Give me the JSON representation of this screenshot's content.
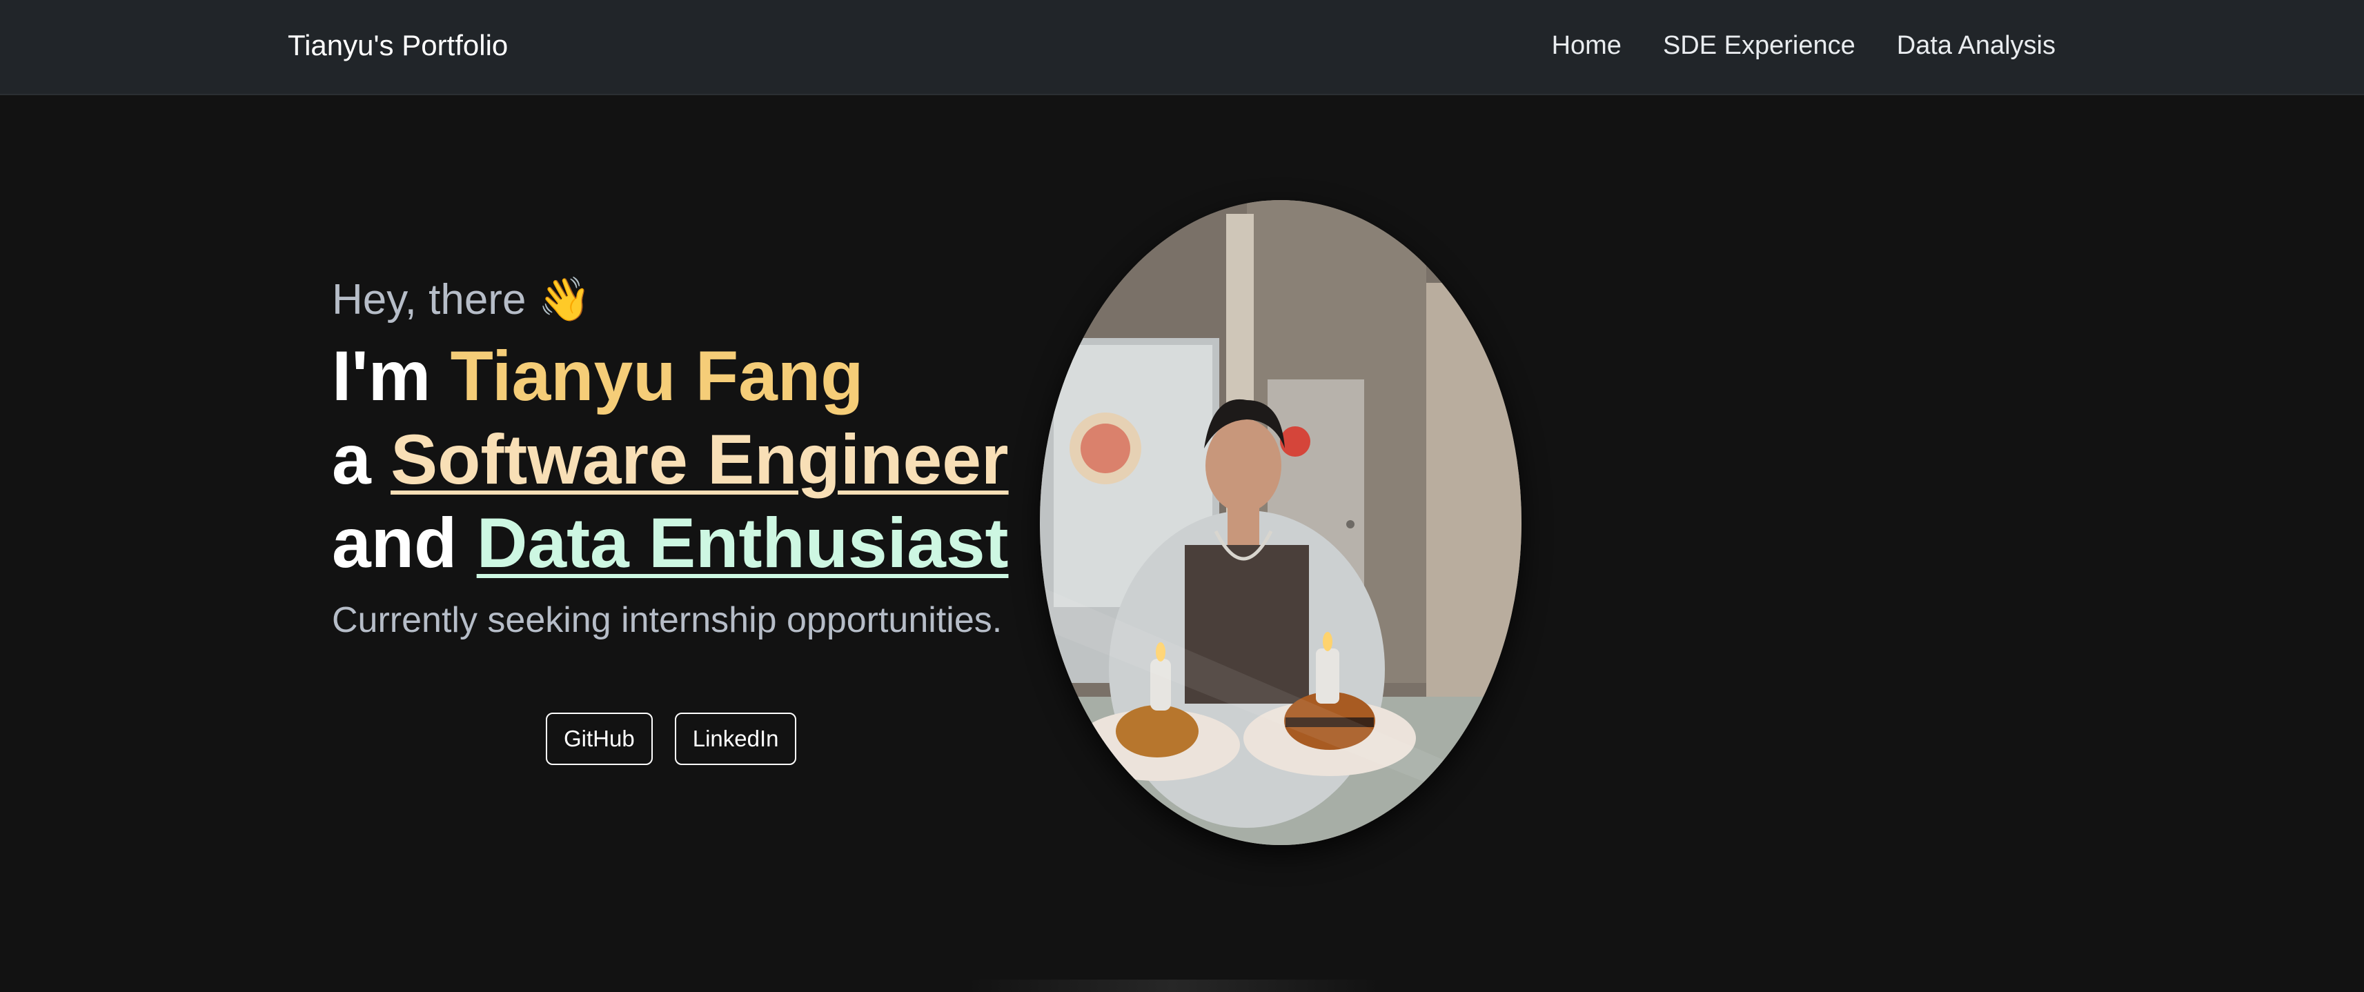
{
  "navbar": {
    "brand": "Tianyu's Portfolio",
    "links": [
      {
        "label": "Home"
      },
      {
        "label": "SDE Experience"
      },
      {
        "label": "Data Analysis"
      }
    ]
  },
  "hero": {
    "greeting": "Hey, there 👋",
    "line1_prefix": "I'm ",
    "name": "Tianyu Fang",
    "line2_prefix": "a ",
    "role": "Software Engineer",
    "line3_prefix": "and ",
    "role2": "Data Enthusiast",
    "subtitle": "Currently seeking internship opportunities.",
    "buttons": {
      "github": "GitHub",
      "linkedin": "LinkedIn"
    }
  },
  "colors": {
    "background": "#121212",
    "navbar": "#212529",
    "name_accent": "#f5cd78",
    "role_accent": "#f8dfb6",
    "data_accent": "#cdf7e2"
  },
  "icons": [
    "waving-hand-icon"
  ]
}
